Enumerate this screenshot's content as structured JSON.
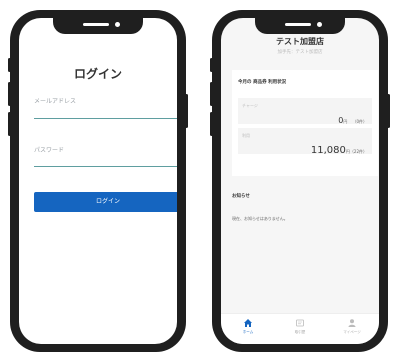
{
  "login": {
    "title": "ログイン",
    "email_label": "メールアドレス",
    "password_label": "パスワード",
    "login_button": "ログイン"
  },
  "dashboard": {
    "store_title": "テスト加盟店",
    "store_subtitle": "加手先：テスト加盟店",
    "card_title": "今月の 商品券 利用状況",
    "charge": {
      "label": "チャージ",
      "value": "0",
      "unit": "円",
      "count": "（0件）"
    },
    "usage": {
      "label": "利用",
      "value": "11,080",
      "unit": "円",
      "count": "（22件）"
    },
    "news_title": "お知らせ",
    "news_empty": "現在、お知らせはありません。",
    "tabs": [
      {
        "label": "ホーム",
        "icon": "home-icon",
        "active": true
      },
      {
        "label": "取引歴",
        "icon": "history-icon",
        "active": false
      },
      {
        "label": "マイページ",
        "icon": "person-icon",
        "active": false
      }
    ]
  },
  "colors": {
    "accent": "#1565c0",
    "input_line": "#5f9ea0",
    "phone_frame": "#1f1f1f"
  }
}
